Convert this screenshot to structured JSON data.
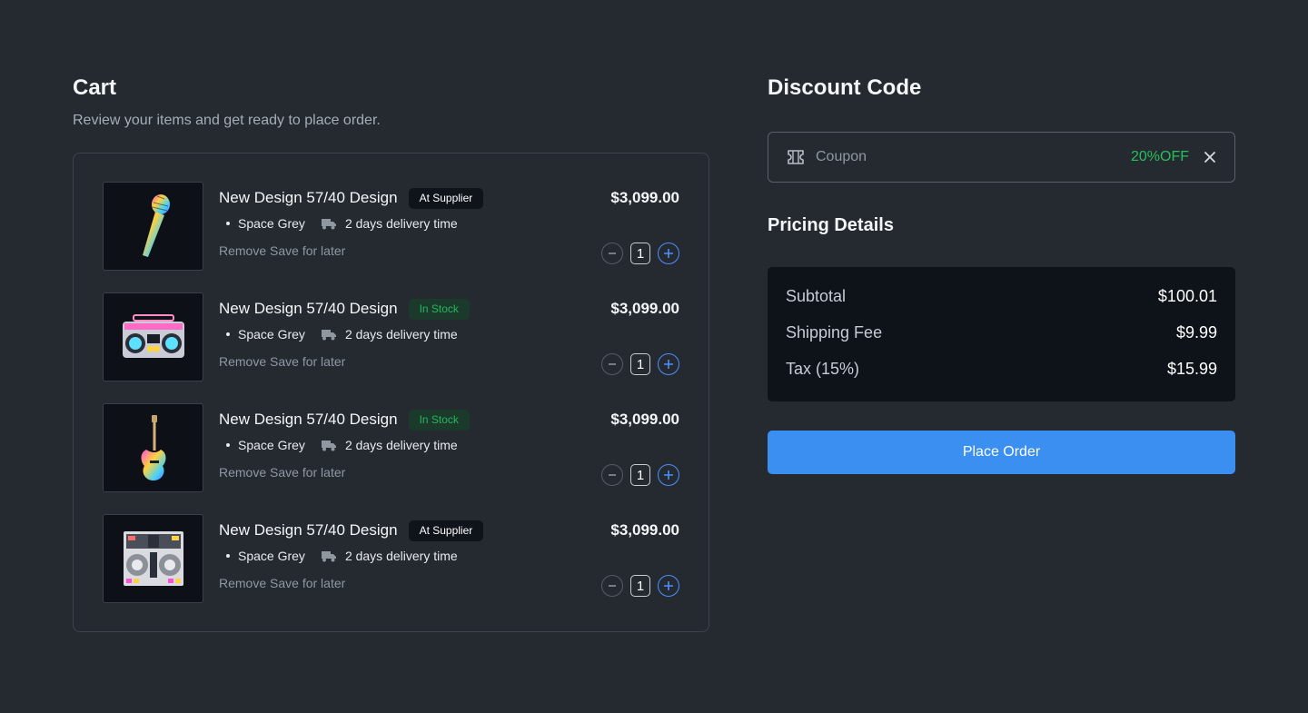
{
  "cart": {
    "title": "Cart",
    "subtitle": "Review your items and get ready to place order.",
    "items": [
      {
        "name": "New Design 57/40 Design",
        "badge": "At Supplier",
        "badge_type": "supplier",
        "color": "Space Grey",
        "delivery": "2 days delivery time",
        "remove_label": "Remove",
        "save_label": "Save for later",
        "price": "$3,099.00",
        "quantity": "1",
        "image": "microphone"
      },
      {
        "name": "New Design 57/40 Design",
        "badge": "In Stock",
        "badge_type": "stock",
        "color": "Space Grey",
        "delivery": "2 days delivery time",
        "remove_label": "Remove",
        "save_label": "Save for later",
        "price": "$3,099.00",
        "quantity": "1",
        "image": "boombox"
      },
      {
        "name": "New Design 57/40 Design",
        "badge": "In Stock",
        "badge_type": "stock",
        "color": "Space Grey",
        "delivery": "2 days delivery time",
        "remove_label": "Remove",
        "save_label": "Save for later",
        "price": "$3,099.00",
        "quantity": "1",
        "image": "guitar"
      },
      {
        "name": "New Design 57/40 Design",
        "badge": "At Supplier",
        "badge_type": "supplier",
        "color": "Space Grey",
        "delivery": "2 days delivery time",
        "remove_label": "Remove",
        "save_label": "Save for later",
        "price": "$3,099.00",
        "quantity": "1",
        "image": "dj-controller"
      }
    ]
  },
  "discount": {
    "title": "Discount Code",
    "placeholder": "Coupon",
    "applied": "20%OFF",
    "icon": "coupon-icon"
  },
  "pricing": {
    "title": "Pricing Details",
    "rows": [
      {
        "label": "Subtotal",
        "value": "$100.01"
      },
      {
        "label": "Shipping Fee",
        "value": "$9.99"
      },
      {
        "label": "Tax (15%)",
        "value": "$15.99"
      }
    ]
  },
  "actions": {
    "place_order": "Place Order"
  },
  "colors": {
    "background": "#252a31",
    "accent": "#3b8ff0",
    "success": "#25c05a"
  }
}
